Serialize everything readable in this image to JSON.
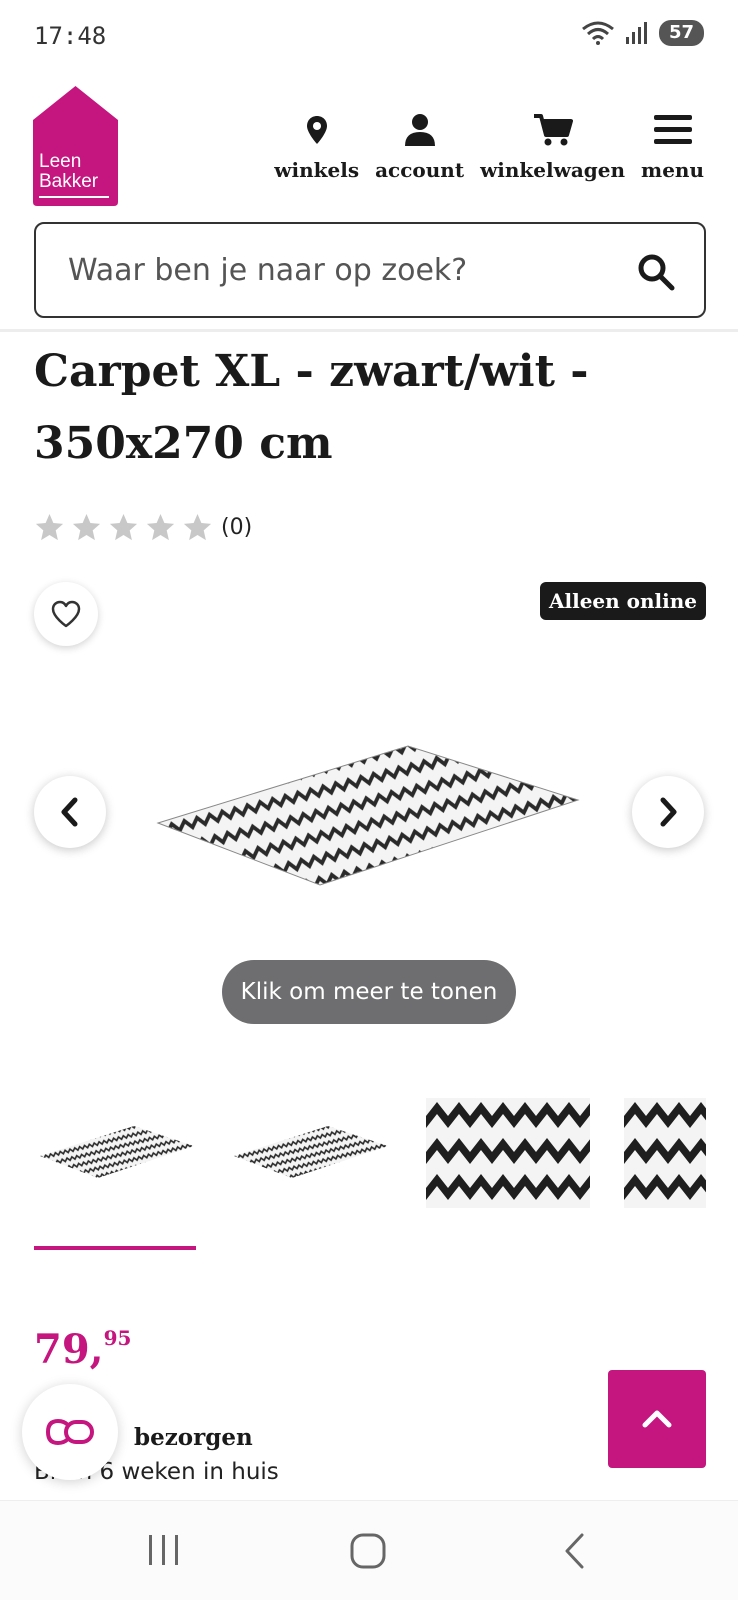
{
  "status_bar": {
    "time": "17:48",
    "battery": "57"
  },
  "brand": {
    "logo_line1": "Leen",
    "logo_line2": "Bakker",
    "color": "#c5157f"
  },
  "nav": [
    {
      "label": "winkels",
      "icon": "location-pin-icon"
    },
    {
      "label": "account",
      "icon": "user-icon"
    },
    {
      "label": "winkelwagen",
      "icon": "cart-icon"
    },
    {
      "label": "menu",
      "icon": "hamburger-icon"
    }
  ],
  "search": {
    "placeholder": "Waar ben je naar op zoek?",
    "icon": "search-icon"
  },
  "product": {
    "title": "Carpet XL - zwart/wit - 350x270 cm",
    "rating": {
      "stars": 0,
      "max": 5,
      "count_text": "(0)"
    },
    "badge": "Alleen online",
    "show_more": "Klik om meer te tonen",
    "price": {
      "integer": "79,",
      "decimals": "95"
    },
    "delivery_title": "Thuisbezorgd",
    "delivery_title_visible": "bezorgen",
    "delivery_sub": "Binnen 6 weken in huis",
    "delivery_sub_visible": "Bi  en 6 weken in huis"
  },
  "system_nav": {
    "icons": [
      "recent-apps-icon",
      "home-icon",
      "back-icon"
    ]
  }
}
